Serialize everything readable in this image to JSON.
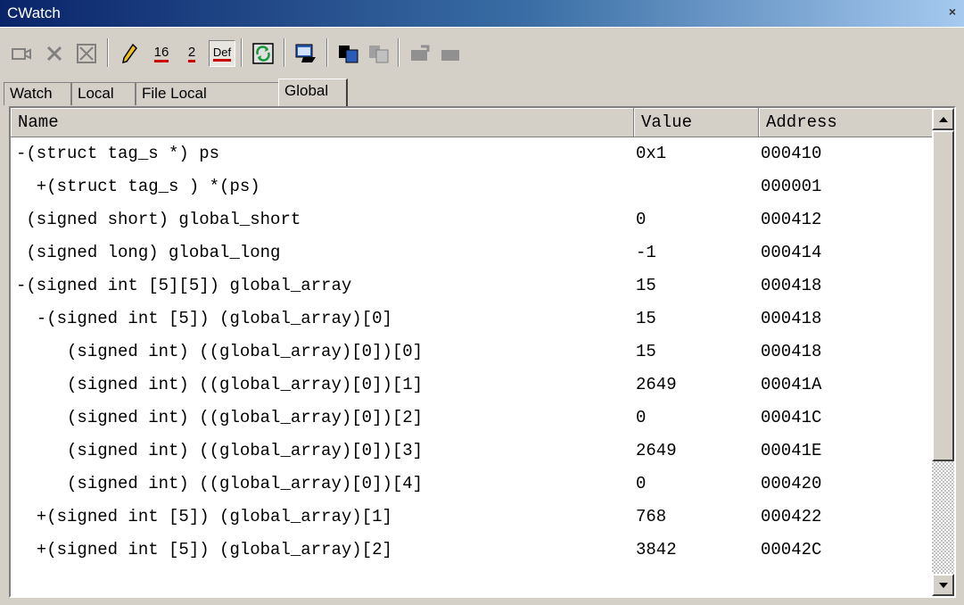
{
  "window": {
    "title": "CWatch",
    "close": "×"
  },
  "toolbar": {
    "icons": [
      "watch-add-icon",
      "delete-icon",
      "delete-all-icon",
      "edit-value-icon",
      "hex-radix-icon",
      "binary-radix-icon",
      "default-radix-icon",
      "refresh-icon",
      "auto-update-icon",
      "copy-icon",
      "paste-icon",
      "move-up-icon",
      "move-down-icon"
    ],
    "hex_label": "16",
    "bin_label": "2",
    "def_label": "Def"
  },
  "tabs": [
    {
      "label": "Watch"
    },
    {
      "label": "Local"
    },
    {
      "label": "File Local"
    },
    {
      "label": "Global",
      "active": true
    }
  ],
  "table": {
    "columns": [
      "Name",
      "Value",
      "Address"
    ],
    "rows": [
      {
        "name": "-(struct tag_s *) ps",
        "value": "0x1",
        "address": "000410"
      },
      {
        "name": "  +(struct tag_s ) *(ps)",
        "value": "",
        "address": "000001"
      },
      {
        "name": " (signed short) global_short",
        "value": "0",
        "address": "000412"
      },
      {
        "name": " (signed long) global_long",
        "value": "-1",
        "address": "000414"
      },
      {
        "name": "-(signed int [5][5]) global_array",
        "value": "15",
        "address": "000418"
      },
      {
        "name": "  -(signed int [5]) (global_array)[0]",
        "value": "15",
        "address": "000418"
      },
      {
        "name": "     (signed int) ((global_array)[0])[0]",
        "value": "15",
        "address": "000418"
      },
      {
        "name": "     (signed int) ((global_array)[0])[1]",
        "value": "2649",
        "address": "00041A"
      },
      {
        "name": "     (signed int) ((global_array)[0])[2]",
        "value": "0",
        "address": "00041C"
      },
      {
        "name": "     (signed int) ((global_array)[0])[3]",
        "value": "2649",
        "address": "00041E"
      },
      {
        "name": "     (signed int) ((global_array)[0])[4]",
        "value": "0",
        "address": "000420"
      },
      {
        "name": "  +(signed int [5]) (global_array)[1]",
        "value": "768",
        "address": "000422"
      },
      {
        "name": "  +(signed int [5]) (global_array)[2]",
        "value": "3842",
        "address": "00042C"
      }
    ]
  }
}
